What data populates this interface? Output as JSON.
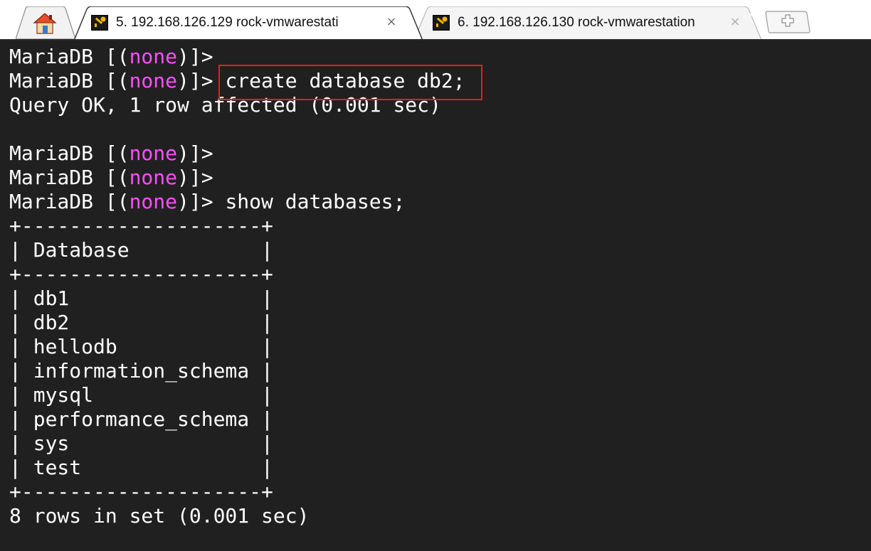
{
  "tabs": [
    {
      "label": "5. 192.168.126.129 rock-vmwarestati",
      "active": true,
      "close": "×"
    },
    {
      "label": "6. 192.168.126.130 rock-vmwarestation",
      "active": false,
      "close": "×"
    }
  ],
  "home_icon": "home-icon",
  "new_tab_icon": "plus-icon",
  "terminal": {
    "prompt": "MariaDB [(",
    "db_none": "none",
    "prompt_end": ")]>",
    "cmd_create": " create database db2;",
    "result_create": "Query OK, 1 row affected (0.001 sec)",
    "cmd_show": " show databases;",
    "table_border": "+--------------------+",
    "table_header": "| Database           |",
    "rows": [
      "| db1                |",
      "| db2                |",
      "| hellodb            |",
      "| information_schema |",
      "| mysql              |",
      "| performance_schema |",
      "| sys                |",
      "| test               |"
    ],
    "result_show": "8 rows in set (0.001 sec)"
  },
  "colors": {
    "terminal_bg": "#202020",
    "text": "#ffffff",
    "none_keyword": "#ff4dff",
    "highlight_box": "#e02020"
  }
}
